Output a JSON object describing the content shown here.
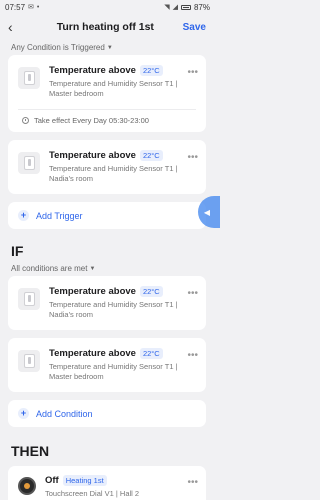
{
  "status": {
    "time": "07:57",
    "battery": "87%"
  },
  "nav": {
    "title": "Turn heating off 1st",
    "save": "Save"
  },
  "when": {
    "mode": "Any Condition is Triggered",
    "conditions": [
      {
        "name": "Temperature above",
        "value": "22°C",
        "desc": "Temperature and Humidity Sensor T1 | Master bedroom"
      },
      {
        "name": "Temperature above",
        "value": "22°C",
        "desc": "Temperature and Humidity Sensor T1 | Nadia's room"
      }
    ],
    "effect": "Take effect Every Day 05:30-23:00",
    "add": "Add Trigger"
  },
  "if": {
    "heading": "IF",
    "mode": "All conditions are met",
    "conditions": [
      {
        "name": "Temperature above",
        "value": "22°C",
        "desc": "Temperature and Humidity Sensor T1 | Nadia's room"
      },
      {
        "name": "Temperature above",
        "value": "22°C",
        "desc": "Temperature and Humidity Sensor T1 | Master bedroom"
      }
    ],
    "add": "Add Condition"
  },
  "then": {
    "heading": "THEN",
    "action": {
      "name": "Off",
      "value": "Heating 1st",
      "desc": "Touchscreen Dial V1 | Hall 2"
    }
  }
}
